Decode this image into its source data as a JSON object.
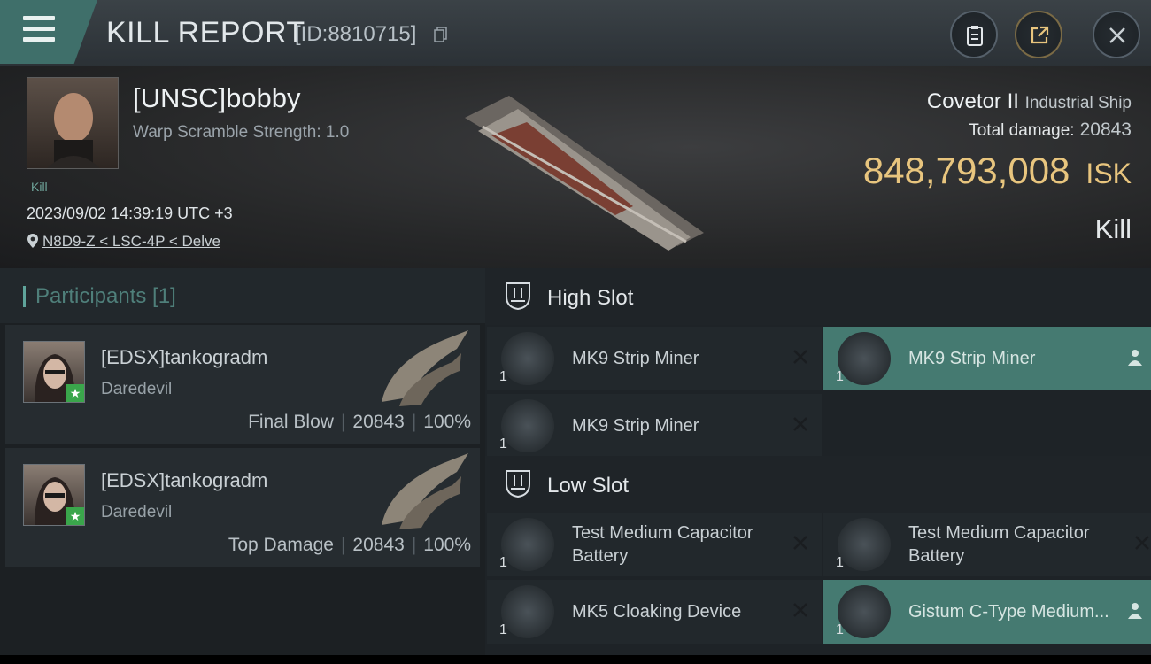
{
  "topbar": {
    "title": "KILL REPORT",
    "report_id": "[ID:8810715]",
    "icons": [
      "menu-icon",
      "copy-icon",
      "clipboard-icon",
      "export-icon",
      "close-icon"
    ]
  },
  "victim": {
    "name": "[UNSC]bobby",
    "warp_scramble": "Warp Scramble Strength: 1.0",
    "tag": "Kill",
    "datetime": "2023/09/02 14:39:19 UTC +3",
    "location": "N8D9-Z < LSC-4P < Delve",
    "ship": "Covetor II",
    "ship_class": "Industrial Ship",
    "total_damage_label": "Total damage:",
    "total_damage": "20843",
    "isk_value": "848,793,008",
    "isk_unit": "ISK",
    "result": "Kill"
  },
  "participants": {
    "title": "Participants [1]",
    "items": [
      {
        "name": "[EDSX]tankogradm",
        "ship": "Daredevil",
        "role": "Final Blow",
        "damage": "20843",
        "percent": "100%"
      },
      {
        "name": "[EDSX]tankogradm",
        "ship": "Daredevil",
        "role": "Top Damage",
        "damage": "20843",
        "percent": "100%"
      }
    ]
  },
  "slots": {
    "high": {
      "title": "High Slot",
      "items": [
        {
          "name": "MK9 Strip Miner",
          "qty": "1",
          "state": "destroyed"
        },
        {
          "name": "MK9 Strip Miner",
          "qty": "1",
          "state": "dropped"
        },
        {
          "name": "MK9 Strip Miner",
          "qty": "1",
          "state": "destroyed"
        }
      ]
    },
    "low": {
      "title": "Low Slot",
      "items": [
        {
          "name": "Test Medium Capacitor Battery",
          "qty": "1",
          "state": "destroyed"
        },
        {
          "name": "Test Medium Capacitor Battery",
          "qty": "1",
          "state": "destroyed"
        },
        {
          "name": "MK5 Cloaking Device",
          "qty": "1",
          "state": "destroyed"
        },
        {
          "name": "Gistum C-Type Medium...",
          "qty": "1",
          "state": "dropped"
        }
      ]
    }
  },
  "colors": {
    "accent": "#457a71",
    "isk": "#e8c57e",
    "menu": "#3f6f6a"
  }
}
